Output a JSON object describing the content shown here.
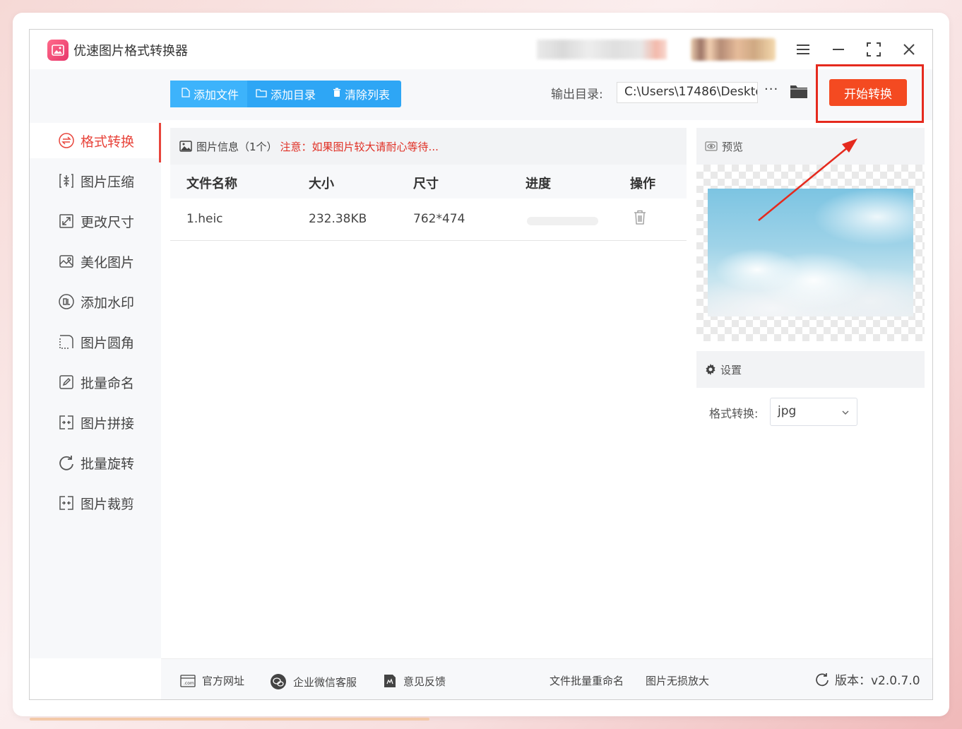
{
  "app": {
    "title": "优速图片格式转换器"
  },
  "sidebar": {
    "items": [
      {
        "label": "格式转换",
        "active": true,
        "icon": "swap-icon"
      },
      {
        "label": "图片压缩",
        "icon": "compress-icon"
      },
      {
        "label": "更改尺寸",
        "icon": "resize-icon"
      },
      {
        "label": "美化图片",
        "icon": "palette-icon"
      },
      {
        "label": "添加水印",
        "icon": "watermark-icon"
      },
      {
        "label": "图片圆角",
        "icon": "round-corner-icon"
      },
      {
        "label": "批量命名",
        "icon": "rename-icon"
      },
      {
        "label": "图片拼接",
        "icon": "join-icon"
      },
      {
        "label": "批量旋转",
        "icon": "rotate-icon"
      },
      {
        "label": "图片裁剪",
        "icon": "crop-icon"
      }
    ]
  },
  "toolbar": {
    "add_file": "添加文件",
    "add_dir": "添加目录",
    "clear_list": "清除列表",
    "output_label": "输出目录:",
    "output_path": "C:\\Users\\17486\\Deskto",
    "more": "···",
    "start": "开始转换"
  },
  "file_panel": {
    "title": "图片信息（1个）",
    "note": "注意：如果图片较大请耐心等待...",
    "columns": [
      "文件名称",
      "大小",
      "尺寸",
      "进度",
      "操作"
    ],
    "rows": [
      {
        "name": "1.heic",
        "size": "232.38KB",
        "dimensions": "762*474",
        "progress": 0
      }
    ]
  },
  "preview": {
    "title": "预览"
  },
  "settings": {
    "title": "设置",
    "format_label": "格式转换:",
    "format_value": "jpg"
  },
  "footer": {
    "website": "官方网址",
    "wechat": "企业微信客服",
    "feedback": "意见反馈",
    "batch_rename": "文件批量重命名",
    "enlarge": "图片无损放大",
    "version": "版本：v2.0.7.0"
  },
  "colors": {
    "accent_red": "#f44a21",
    "highlight": "#e52a1e",
    "toolbar_blue": "#2ea6f5",
    "active_text": "#e8453c"
  }
}
